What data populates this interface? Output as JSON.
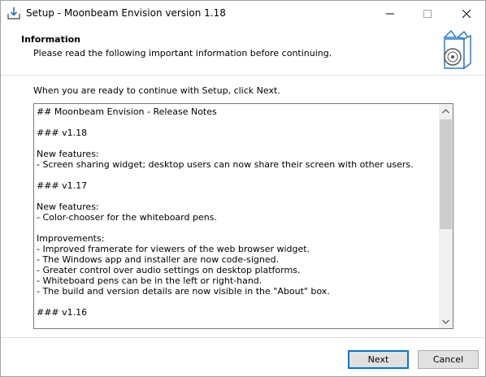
{
  "window": {
    "title": "Setup - Moonbeam Envision version 1.18",
    "controls": [
      "minimize",
      "maximize",
      "close"
    ]
  },
  "header": {
    "title": "Information",
    "subtitle": "Please read the following important information before continuing.",
    "icon": "setup-box-disc-icon"
  },
  "prompt": "When you are ready to continue with Setup, click Next.",
  "notes": {
    "lines": [
      "## Moonbeam Envision - Release Notes",
      "",
      "### v1.18",
      "",
      "New features:",
      "- Screen sharing widget; desktop users can now share their screen with other users.",
      "",
      "### v1.17",
      "",
      "New features:",
      "- Color-chooser for the whiteboard pens.",
      "",
      "Improvements:",
      "- Improved framerate for viewers of the web browser widget.",
      "- The Windows app and installer are now code-signed.",
      "- Greater control over audio settings on desktop platforms.",
      "- Whiteboard pens can be in the left or right-hand.",
      "- The build and version details are now visible in the \"About\" box.",
      "",
      "### v1.16"
    ]
  },
  "buttons": {
    "next": "Next",
    "cancel": "Cancel"
  },
  "colors": {
    "accent": "#0078d7",
    "button_bg": "#e1e1e1",
    "scroll_thumb": "#cdcdcd"
  }
}
